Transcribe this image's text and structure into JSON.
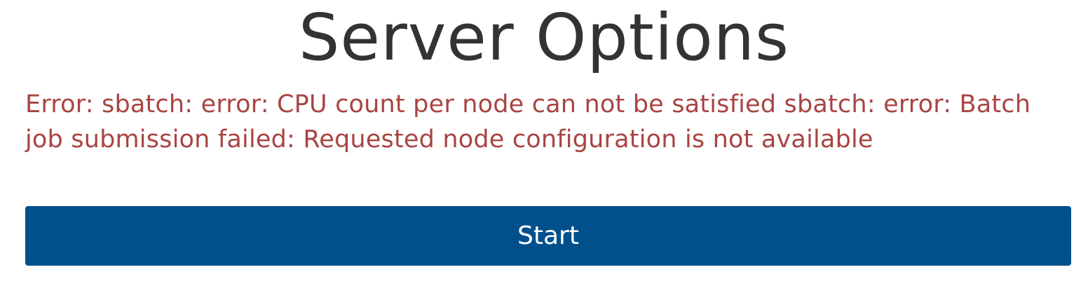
{
  "header": {
    "title": "Server Options"
  },
  "error": {
    "message": "Error: sbatch: error: CPU count per node can not be satisfied sbatch: error: Batch job submission failed: Requested node configuration is not available"
  },
  "actions": {
    "start_label": "Start"
  },
  "colors": {
    "title_text": "#333333",
    "error_text": "#a94442",
    "button_bg": "#00508c",
    "button_text": "#ffffff"
  }
}
